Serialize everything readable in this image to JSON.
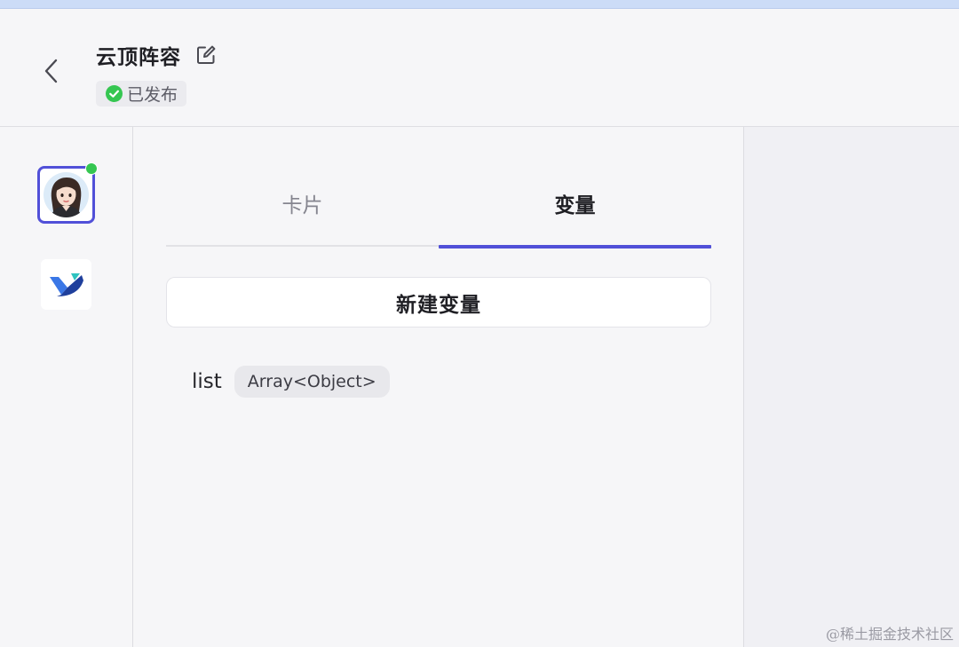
{
  "header": {
    "title": "云顶阵容",
    "status": "已发布"
  },
  "sidebar": {
    "items": [
      {
        "name": "avatar",
        "online": true
      },
      {
        "name": "app-logo"
      }
    ]
  },
  "panel": {
    "tabs": [
      {
        "label": "卡片",
        "active": false
      },
      {
        "label": "变量",
        "active": true
      }
    ],
    "new_variable_label": "新建变量",
    "variables": [
      {
        "name": "list",
        "type": "Array<Object>"
      }
    ]
  },
  "colors": {
    "accent": "#5150d8",
    "success": "#35c651",
    "background": "#f6f6f8"
  },
  "watermark": "@稀土掘金技术社区"
}
